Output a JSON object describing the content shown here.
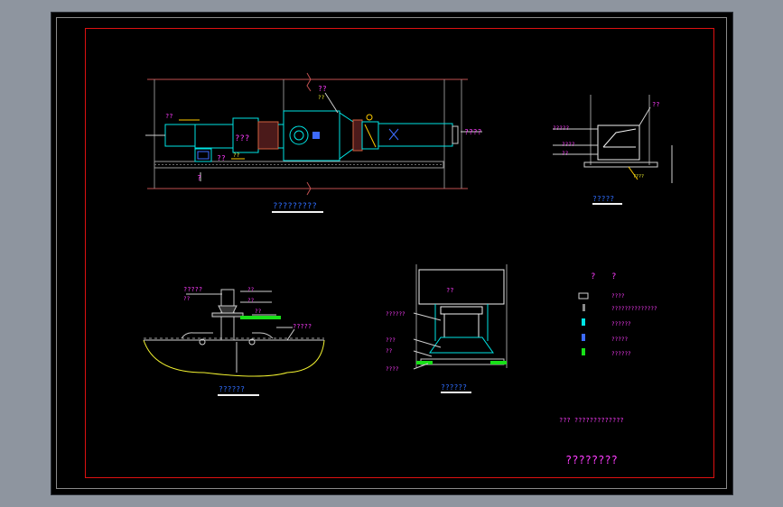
{
  "colors": {
    "background": "#8e959f",
    "sheet": "#000000",
    "red": "#dd1111",
    "cyan": "#00e5e5",
    "magenta": "#ff3cff",
    "yellow": "#f2f230",
    "green": "#18e018",
    "white": "#f2f2f2",
    "blue": "#3d6bff",
    "wall": "#c05050"
  },
  "plan": {
    "label_intake": "??",
    "label_top": "??",
    "label_top_sub": "??",
    "label_unit": "???",
    "label_base": "??",
    "label_base2": "??",
    "label_exhaust": "????",
    "label_small": "?",
    "title": "?????????"
  },
  "section_right": {
    "label_1": "?????",
    "label_2": "????",
    "label_3": "??",
    "label_top": "??",
    "label_base": "????",
    "title": "?????"
  },
  "detail_left": {
    "label_1": "?????",
    "label_2": "??",
    "label_3": "??",
    "label_4": "??",
    "label_5": "??",
    "label_6": "?????",
    "title": "??????"
  },
  "detail_mid": {
    "label_top": "??",
    "label_1": "??????",
    "label_2": "???",
    "label_3": "??",
    "label_4": "????",
    "title": "??????"
  },
  "legend": {
    "heading_1": "?",
    "heading_2": "?",
    "items": [
      {
        "label": "????"
      },
      {
        "label": "??????????????"
      },
      {
        "label": "??????"
      },
      {
        "label": "?????"
      },
      {
        "label": "??????"
      }
    ]
  },
  "note": "???  ?????????????",
  "drawing_title": "????????"
}
